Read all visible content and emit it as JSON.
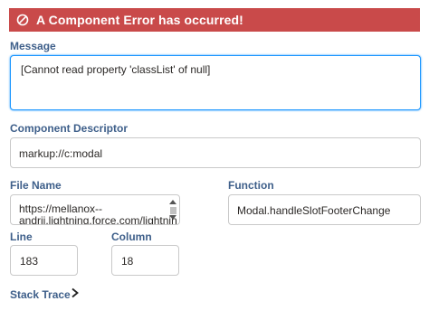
{
  "banner": {
    "title": "A Component Error has occurred!",
    "icon": "error-circle-icon"
  },
  "message": {
    "label": "Message",
    "value": "[Cannot read property 'classList' of null]"
  },
  "component": {
    "label": "Component Descriptor",
    "value": "markup://c:modal"
  },
  "file": {
    "label": "File Name",
    "line1": "https://mellanox--",
    "line2": "andrii.lightning.force.com/lightnin"
  },
  "function": {
    "label": "Function",
    "value": "Modal.handleSlotFooterChange"
  },
  "line": {
    "label": "Line",
    "value": "183"
  },
  "column": {
    "label": "Column",
    "value": "18"
  },
  "stack": {
    "label": "Stack Trace",
    "icon": "chevron-right-icon"
  },
  "colors": {
    "banner": "#c94a4a",
    "label": "#3e5f8a",
    "focus": "#1b96ff"
  }
}
